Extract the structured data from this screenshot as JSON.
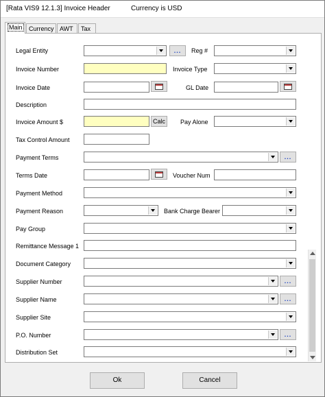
{
  "window": {
    "title": "[Rata VIS9 12.1.3] Invoice Header",
    "subtitle": "Currency is USD"
  },
  "tabs": [
    {
      "label": "Main"
    },
    {
      "label": "Currency"
    },
    {
      "label": "AWT"
    },
    {
      "label": "Tax"
    }
  ],
  "labels": {
    "legal_entity": "Legal Entity",
    "reg": "Reg #",
    "invoice_number": "Invoice Number",
    "invoice_type": "Invoice Type",
    "invoice_date": "Invoice Date",
    "gl_date": "GL Date",
    "description": "Description",
    "invoice_amount": "Invoice Amount $",
    "pay_alone": "Pay Alone",
    "tax_control_amount": "Tax Control Amount",
    "payment_terms": "Payment Terms",
    "terms_date": "Terms Date",
    "voucher_num": "Voucher Num",
    "payment_method": "Payment Method",
    "payment_reason": "Payment Reason",
    "bank_charge_bearer": "Bank Charge Bearer",
    "pay_group": "Pay Group",
    "remittance_message_1": "Remittance Message 1",
    "document_category": "Document Category",
    "supplier_number": "Supplier Number",
    "supplier_name": "Supplier Name",
    "supplier_site": "Supplier Site",
    "po_number": "P.O. Number",
    "distribution_set": "Distribution Set"
  },
  "buttons": {
    "ellipsis": "...",
    "calc": "Calc",
    "ok": "Ok",
    "cancel": "Cancel"
  },
  "colors": {
    "required_field": "#ffffc0",
    "ellipsis": "#1a3fbf"
  }
}
